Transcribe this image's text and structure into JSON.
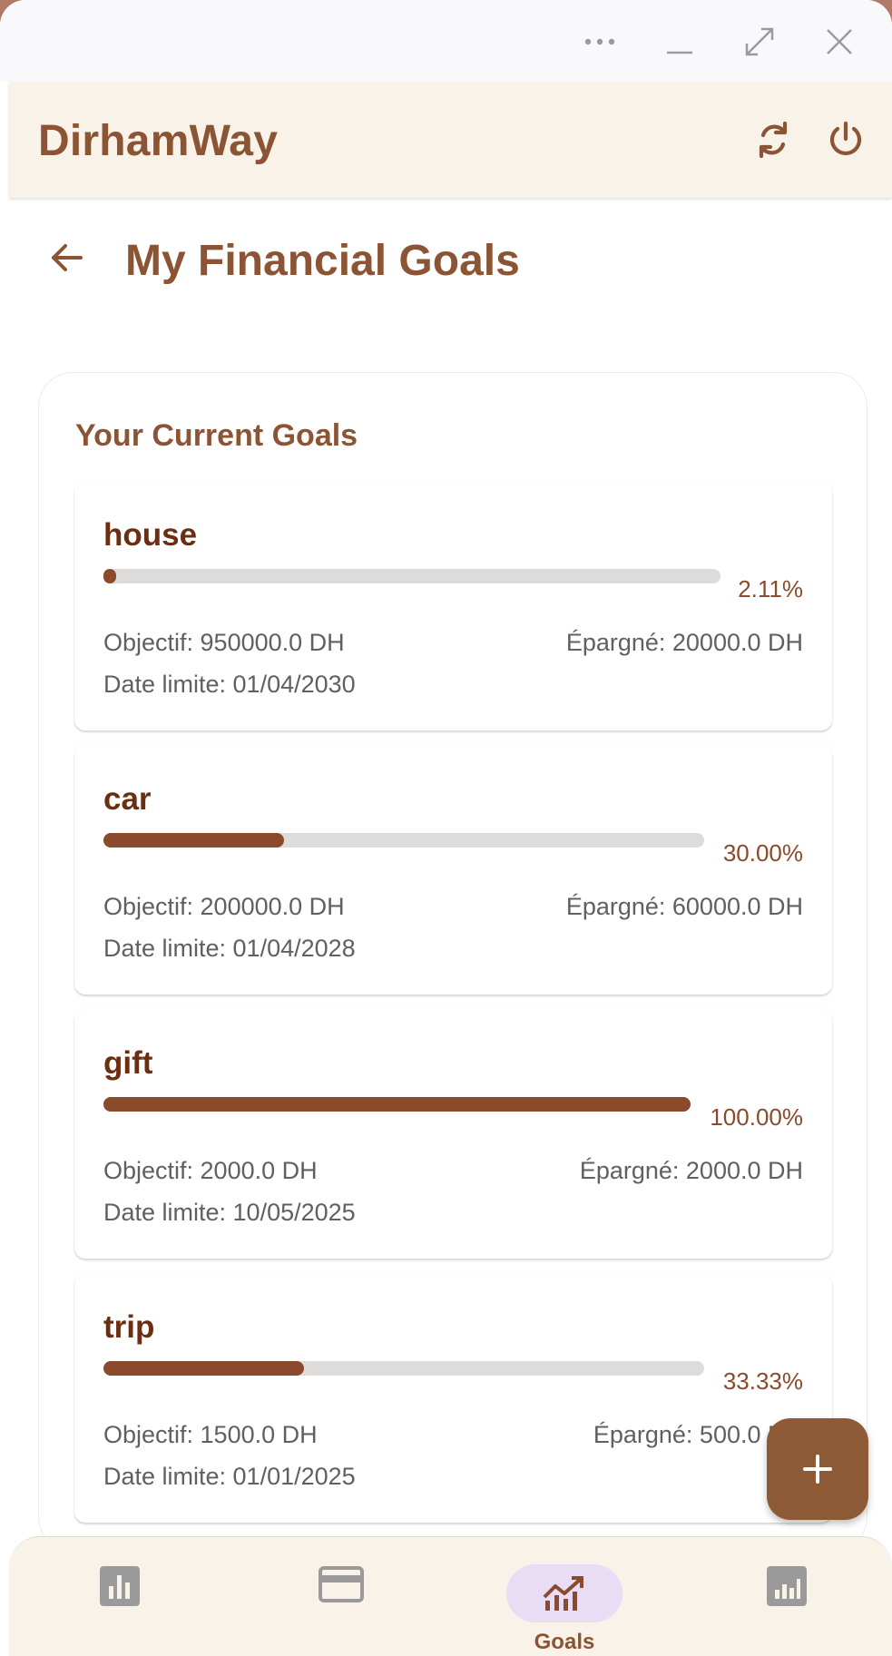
{
  "app": {
    "title": "DirhamWay"
  },
  "page": {
    "title": "My Financial Goals"
  },
  "panel": {
    "title": "Your Current Goals"
  },
  "goals": [
    {
      "name": "house",
      "progress": 0.0211,
      "percent": "2.11%",
      "target": "Objectif: 950000.0 DH",
      "saved": "Épargné: 20000.0 DH",
      "deadline": "Date limite: 01/04/2030"
    },
    {
      "name": "car",
      "progress": 0.3,
      "percent": "30.00%",
      "target": "Objectif: 200000.0 DH",
      "saved": "Épargné: 60000.0 DH",
      "deadline": "Date limite: 01/04/2028"
    },
    {
      "name": "gift",
      "progress": 1.0,
      "percent": "100.00%",
      "target": "Objectif: 2000.0 DH",
      "saved": "Épargné: 2000.0 DH",
      "deadline": "Date limite: 10/05/2025"
    },
    {
      "name": "trip",
      "progress": 0.3333,
      "percent": "33.33%",
      "target": "Objectif: 1500.0 DH",
      "saved": "Épargné: 500.0 DH",
      "deadline": "Date limite: 01/01/2025"
    }
  ],
  "nav": {
    "items": [
      {
        "icon": "bar-chart-icon",
        "label": ""
      },
      {
        "icon": "credit-card-icon",
        "label": ""
      },
      {
        "icon": "trending-up-icon",
        "label": "Goals",
        "active": true
      },
      {
        "icon": "analytics-icon",
        "label": ""
      }
    ]
  },
  "colors": {
    "brand": "#8b5535",
    "progress_fill": "#8b4a2c",
    "goal_name": "#6b2e10",
    "appbar_bg": "#f8f2e9",
    "active_pill": "#e9ddf6"
  }
}
